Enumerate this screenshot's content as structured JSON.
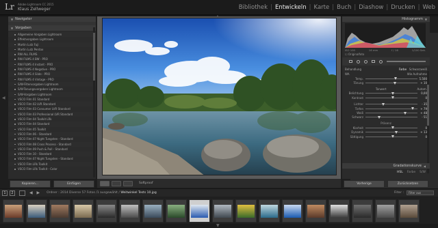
{
  "app": {
    "small_title": "Adobe Lightroom CC 2015",
    "user": "Klaus Zellweger",
    "logo": "Lr"
  },
  "modules": [
    "Bibliothek",
    "Entwickeln",
    "Karte",
    "Buch",
    "Diashow",
    "Drucken",
    "Web"
  ],
  "active_module": "Entwickeln",
  "left_panel": {
    "navigator_label": "Navigator",
    "zoom_options": [
      "Einpas.",
      "Ausfül.",
      "1:1",
      "1:4"
    ],
    "presets_label": "Vorgaben",
    "presets": [
      "Allgemeine Vorgaben Lightroom",
      "Effektvorgaben Lightroom",
      "Martin Lutz Fuji",
      "Martin Lutz Pentax",
      "RNI ALL FILMS",
      "RNI FILMS 4 BW - PRO",
      "RNI FILMS 4 Instant - PRO",
      "RNI FILMS 4 Negative - PRO",
      "RNI FILMS 4 Slide - PRO",
      "RNI FILMS 4 Vintage - PRO",
      "S/W-Filtervorgaben Lightroom",
      "S/W-Tonungsvorgaben Lightroom",
      "S/W-Vorgaben Lightroom",
      "VSCO Film 01 Standard",
      "VSCO Film 02 LVR Standard",
      "VSCO Film 03 Consumer LVR Standard",
      "VSCO Film 03 Professional LVR Standard",
      "VSCO Film 04 Toolkit LRk",
      "VSCO Film 04 Standard",
      "VSCO Film 05 Toolkit",
      "VSCO Film 06 - Standard",
      "VSCO Film 07 Night Tungsten - Standard",
      "VSCO Film 08 Cross Process - Standard",
      "VSCO Film 09 Push & Pull - Standard",
      "VSCO Film 10 - Standard",
      "VSCO Film 07 Night Tungsten - Standard",
      "VSCO Film LRk Toolkit",
      "VSCO Film LRk Toolkit - Color"
    ],
    "copy_button": "Kopieren...",
    "paste_button": "Einfügen"
  },
  "toolbar": {
    "softproof_label": "Softproof"
  },
  "right_panel": {
    "histogram_label": "Histogramm",
    "hist_left": "ISO 100",
    "hist_mid": "16 mm",
    "hist_mid2": "f / 16",
    "hist_right": "1/100 Sek.",
    "original_photo": "Originalfoto",
    "basic": {
      "treatment_label": "Behandlung",
      "color": "Farbe",
      "bw": "Schwarzweiß",
      "wb_label": "WA",
      "wb_value": "Wie Aufnahme",
      "temp_label": "Temp.",
      "temp_value": "5.500",
      "tint_label": "Tönung",
      "tint_value": "+ 10",
      "tone_label": "Tonwert",
      "auto_label": "Autom.",
      "exposure_label": "Belichtung",
      "exposure_value": "0,00",
      "contrast_label": "Kontrast",
      "contrast_value": "0",
      "highlights_label": "Lichter",
      "highlights_value": "- 35",
      "shadows_label": "Tiefen",
      "shadows_value": "+ 79",
      "whites_label": "Weiß",
      "whites_value": "+ 48",
      "blacks_label": "Schwarz",
      "blacks_value": "- 51",
      "presence_label": "Präsenz",
      "clarity_label": "Klarheit",
      "clarity_value": "0",
      "vibrance_label": "Dynamik",
      "vibrance_value": "+ 13",
      "saturation_label": "Sättigung",
      "saturation_value": "0"
    },
    "gradation_label": "Gradationskurve",
    "hsl_items": [
      "HSL",
      "Farbe",
      "S/W"
    ],
    "prev_button": "Vorherige",
    "reset_button": "Zurücksetzen"
  },
  "filmstrip_bar": {
    "page1": "1",
    "page2": "2",
    "path_prefix": "Ordner : 2014 Diverse",
    "path_count": "57 Fotos /1 ausgewählt /",
    "path_file": "Weitwinkel Tests 10.jpg",
    "filter_label": "Filter :",
    "filter_value": "Filter aus"
  },
  "filmstrip_count": 18,
  "selected_index": 8
}
